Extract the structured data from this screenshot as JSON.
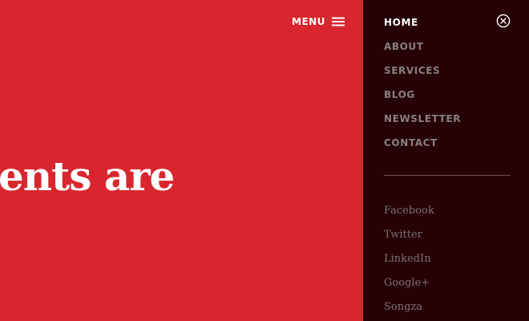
{
  "colors": {
    "hero_background": "#d9262e",
    "drawer_background": "#260206",
    "nav_active": "#ffffff",
    "nav_inactive": "#8a7f80",
    "social_link": "#7f7173",
    "divider": "#6a5457"
  },
  "header": {
    "menu_label": "MENU",
    "menu_icon": "hamburger-icon"
  },
  "hero": {
    "headline": "ents are"
  },
  "drawer": {
    "close_icon": "close-icon",
    "nav": [
      {
        "label": "HOME",
        "active": true
      },
      {
        "label": "ABOUT",
        "active": false
      },
      {
        "label": "SERVICES",
        "active": false
      },
      {
        "label": "BLOG",
        "active": false
      },
      {
        "label": "NEWSLETTER",
        "active": false
      },
      {
        "label": "CONTACT",
        "active": false
      }
    ],
    "social": [
      {
        "label": "Facebook"
      },
      {
        "label": "Twitter"
      },
      {
        "label": "LinkedIn"
      },
      {
        "label": "Google+"
      },
      {
        "label": "Songza"
      }
    ]
  }
}
